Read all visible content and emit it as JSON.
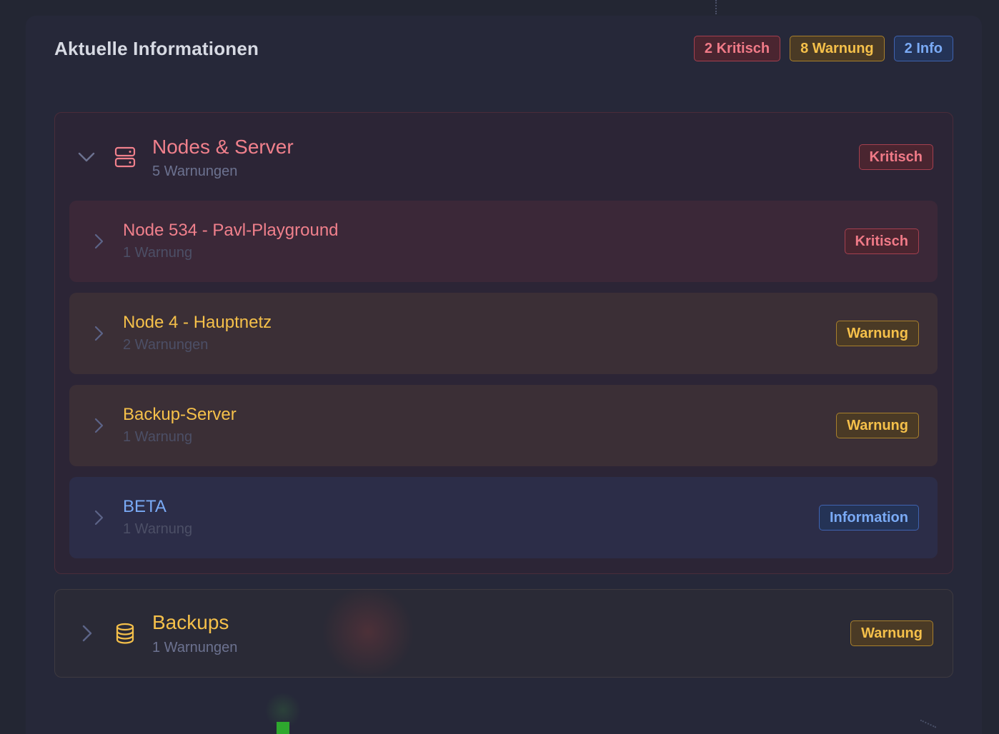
{
  "panel": {
    "title": "Aktuelle Informationen",
    "counts": {
      "critical": "2 Kritisch",
      "warning": "8 Warnung",
      "info": "2 Info"
    }
  },
  "groups": [
    {
      "title": "Nodes & Server",
      "subtitle": "5 Warnungen",
      "badge": "Kritisch",
      "expanded": true,
      "icon": "server-icon",
      "color": "#f0808c",
      "items": [
        {
          "title": "Node 534 - Pavl-Playground",
          "subtitle": "1 Warnung",
          "badge": "Kritisch",
          "color": "#f0808c"
        },
        {
          "title": "Node 4 - Hauptnetz",
          "subtitle": "2 Warnungen",
          "badge": "Warnung",
          "color": "#f5c04a"
        },
        {
          "title": "Backup-Server",
          "subtitle": "1 Warnung",
          "badge": "Warnung",
          "color": "#f5c04a"
        },
        {
          "title": "BETA",
          "subtitle": "1 Warnung",
          "badge": "Information",
          "color": "#7aaaf5"
        }
      ]
    },
    {
      "title": "Backups",
      "subtitle": "1 Warnungen",
      "badge": "Warnung",
      "expanded": false,
      "icon": "database-icon",
      "color": "#f5c04a"
    }
  ]
}
